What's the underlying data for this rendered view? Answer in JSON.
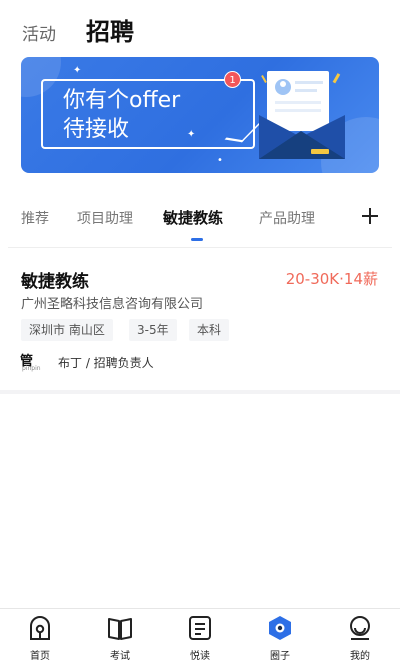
{
  "header": {
    "tab_inactive": "活动",
    "tab_active": "招聘"
  },
  "banner": {
    "text": "你有个offer\n待接收",
    "badge_count": "1",
    "background_color": "#3474e4"
  },
  "category_tabs": {
    "items": [
      "推荐",
      "项目助理",
      "敏捷教练",
      "产品助理"
    ],
    "active_index": 2,
    "accent_color": "#2d6fe6",
    "add_icon": "plus-icon"
  },
  "job": {
    "title": "敏捷教练",
    "salary": "20-30K·14薪",
    "salary_color": "#f06a5a",
    "company": "广州圣略科技信息咨询有限公司",
    "tags": [
      "深圳市 南山区",
      "3-5年",
      "本科"
    ],
    "recruiter_logo_main": "管",
    "recruiter_logo_sub": "pinpin",
    "recruiter": "布丁 / 招聘负责人"
  },
  "bottom_nav": {
    "items": [
      {
        "label": "首页",
        "icon": "home-icon"
      },
      {
        "label": "考试",
        "icon": "book-icon"
      },
      {
        "label": "悦读",
        "icon": "reading-icon"
      },
      {
        "label": "圈子",
        "icon": "circle-icon"
      },
      {
        "label": "我的",
        "icon": "profile-icon"
      }
    ]
  }
}
